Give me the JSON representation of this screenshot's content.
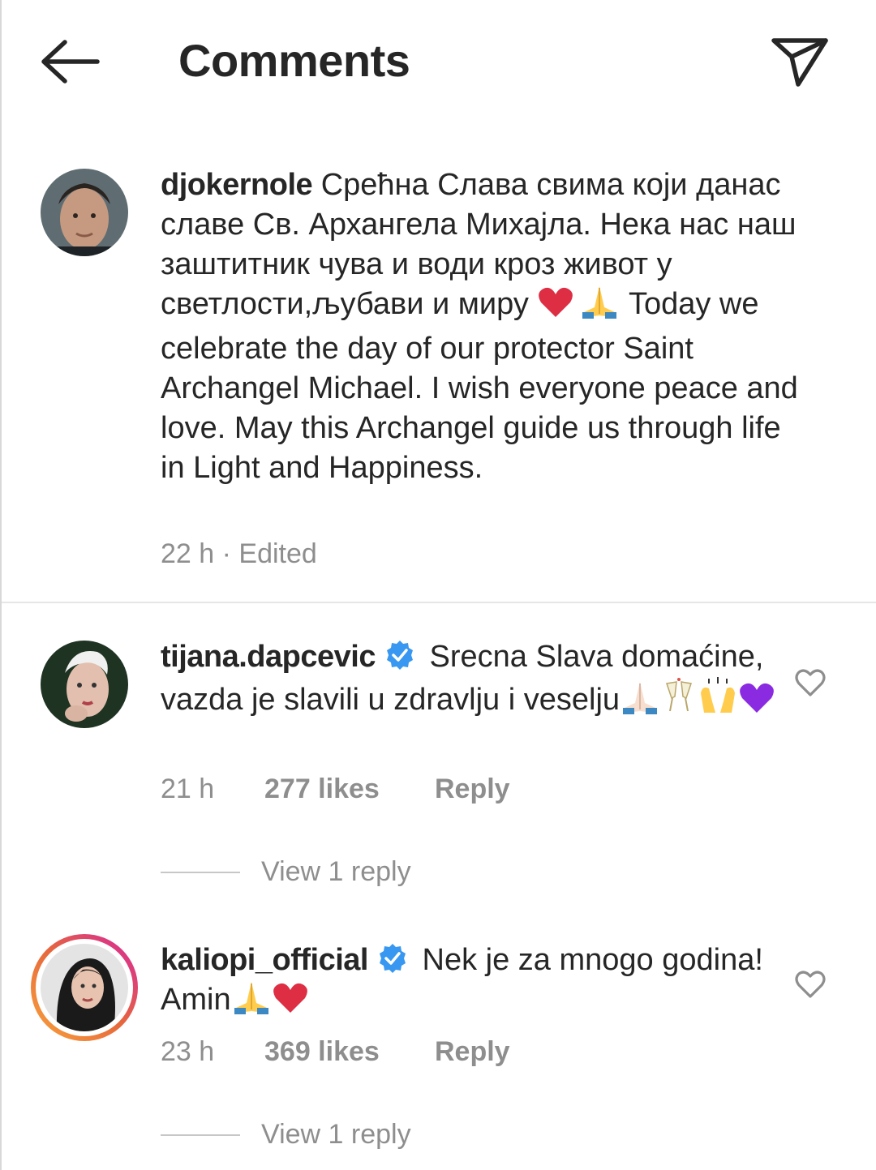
{
  "header": {
    "title": "Comments"
  },
  "caption": {
    "username": "djokernole",
    "text_before_emoji": " Срећна Слава свима који данас славе Св. Архангела Михајла. Нека нас наш заштитник чува и води кроз живот у светлости,љубави и миру ",
    "text_after_emoji": " Today we celebrate the day of our protector Saint Archangel Michael. I wish everyone peace and love. May this Archangel guide us through life in Light and Happiness.",
    "time": "22 h",
    "separator": " · ",
    "edited": "Edited"
  },
  "comments": [
    {
      "username": "tijana.dapcevic",
      "text": "Srecna Slava domaćine, vazda je slavili u zdravlju i veselju",
      "time": "21 h",
      "likes": "277 likes",
      "reply": "Reply",
      "view_replies": "View 1 reply",
      "emojis": [
        "folded-hands-light",
        "clinking-glasses",
        "raising-hands",
        "purple-heart"
      ]
    },
    {
      "username": "kaliopi_official",
      "text": "Nek je za mnogo godina! Amin",
      "time": "23 h",
      "likes": "369 likes",
      "reply": "Reply",
      "view_replies": "View 1 reply",
      "emojis": [
        "folded-hands",
        "red-heart"
      ]
    }
  ],
  "colors": {
    "text": "#262626",
    "secondary": "#8e8e8e",
    "verified": "#3897f0",
    "story_ring_start": "#f9a33b",
    "story_ring_end": "#d6249f"
  }
}
